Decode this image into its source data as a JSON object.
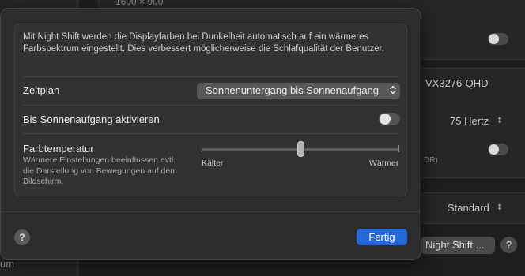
{
  "background": {
    "resolution_label": "1600 × 900",
    "display_value": "VX3276-QHD",
    "refresh_rate": "75 Hertz",
    "hdr_fragment": "DR)",
    "preset_value": "Standard",
    "night_shift_button": "Night Shift ...",
    "help_label": "?",
    "sidebar_fragment": "um"
  },
  "dialog": {
    "description": "Mit Night Shift werden die Displayfarben bei Dunkelheit automatisch auf ein wärmeres Farbspektrum eingestellt. Dies verbessert möglicherweise die Schlafqualität der Benutzer.",
    "schedule": {
      "label": "Zeitplan",
      "selected": "Sonnenuntergang bis Sonnenaufgang"
    },
    "enable_until_sunrise": {
      "label": "Bis Sonnenaufgang aktivieren",
      "checked": false
    },
    "color_temperature": {
      "label": "Farbtemperatur",
      "description": "Wärmere Einstellungen beeinflussen evtl. die Darstellung von Bewegungen auf dem Bildschirm.",
      "min_label": "Kälter",
      "max_label": "Wärmer",
      "value_fraction": 0.5
    },
    "help_label": "?",
    "done_label": "Fertig"
  },
  "colors": {
    "accent": "#2768d8",
    "dialog_bg": "#2c2c2e",
    "panel_bg": "#323234"
  }
}
